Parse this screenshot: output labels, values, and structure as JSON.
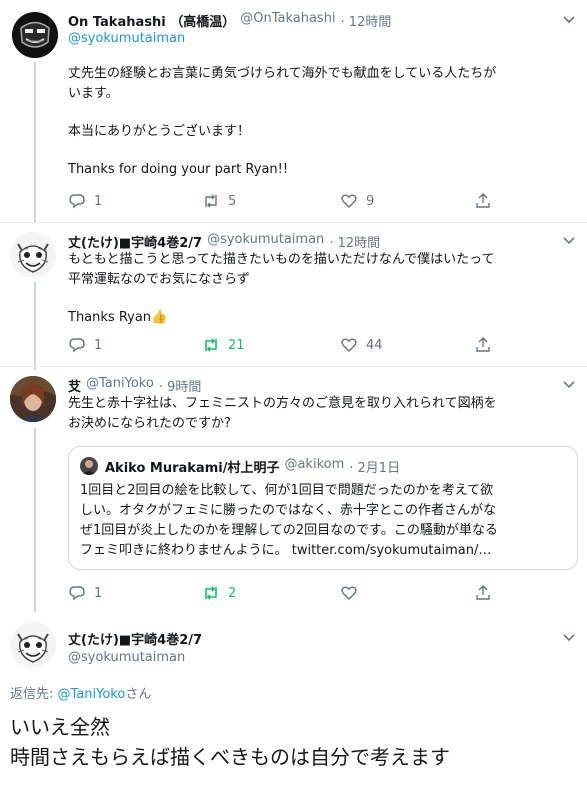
{
  "tweets": [
    {
      "display_name": "On Takahashi （高橋温）",
      "handle": "@OnTakahashi",
      "time": "· 12時間",
      "reply_to": "@syokumutaiman",
      "lines": [
        "丈先生の経験とお言葉に勇気づけられて海外でも献血をしている人たちが",
        "います。",
        "",
        "本当にありがとうございます！",
        "",
        "Thanks for doing your part Ryan!!"
      ],
      "reply_count": "1",
      "retweet_count": "5",
      "like_count": "9"
    },
    {
      "display_name": "丈(たけ)■宇崎4巻2/7",
      "handle": "@syokumutaiman",
      "time": "· 12時間",
      "lines": [
        "もともと描こうと思ってた描きたいものを描いただけなんで僕はいたって",
        "平常運転なのでお気になさらず",
        "",
        "Thanks Ryan👍"
      ],
      "reply_count": "1",
      "retweet_count": "21",
      "like_count": "44"
    },
    {
      "display_name": "𦫿",
      "handle": "@TaniYoko",
      "time": "· 9時間",
      "lines": [
        "先生と赤十字社は、フェミニストの方々のご意見を取り入れられて図柄を",
        "お決めになられたのですか?"
      ],
      "quote": {
        "display_name": "Akiko Murakami/村上明子",
        "handle": "@akikom",
        "time": "· 2月1日",
        "lines": [
          "1回目と2回目の絵を比較して、何が1回目で問題だったのかを考えて欲",
          "しい。オタクがフェミに勝ったのではなく、赤十字とこの作者さんがな",
          "ぜ1回目が炎上したのかを理解しての2回目なのです。この騒動が単なる",
          "フェミ叩きに終わりませんように。 twitter.com/syokumutaiman/…"
        ]
      },
      "reply_count": "1",
      "retweet_count": "2",
      "like_count": ""
    }
  ],
  "main_tweet": {
    "display_name": "丈(たけ)■宇崎4巻2/7",
    "handle": "@syokumutaiman",
    "reply_label": "返信先:",
    "reply_to": "@TaniYoko",
    "reply_suffix": "さん",
    "line1": "いいえ全然",
    "line2": "時間さえもらえば描くべきものは自分で考えます"
  },
  "colors": {
    "accent": "#1b95e0",
    "retweet": "#17bf63",
    "muted": "#657786"
  },
  "icons": [
    "reply-icon",
    "retweet-icon",
    "like-icon",
    "share-icon",
    "chevron-down-icon"
  ]
}
